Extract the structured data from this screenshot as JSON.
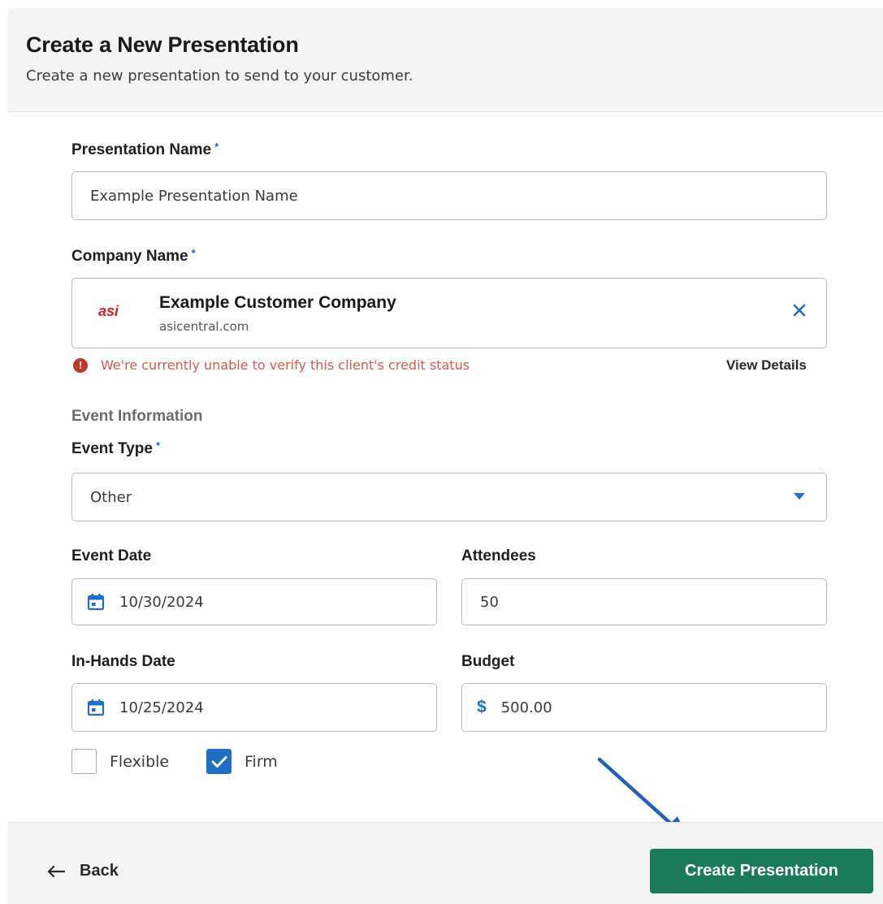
{
  "header": {
    "title": "Create a New Presentation",
    "subtitle": "Create a new presentation to send to your customer."
  },
  "form": {
    "presentation_name": {
      "label": "Presentation Name",
      "value": "Example Presentation Name"
    },
    "company_name": {
      "label": "Company Name",
      "selected_name": "Example Customer Company",
      "selected_domain": "asicentral.com",
      "logo_text": "asi",
      "warning": "We're currently unable to verify this client's credit status",
      "view_details": "View Details"
    },
    "event_section_title": "Event Information",
    "event_type": {
      "label": "Event Type",
      "value": "Other"
    },
    "event_date": {
      "label": "Event Date",
      "value": "10/30/2024"
    },
    "attendees": {
      "label": "Attendees",
      "value": "50"
    },
    "in_hands_date": {
      "label": "In-Hands Date",
      "value": "10/25/2024"
    },
    "budget": {
      "label": "Budget",
      "currency_symbol": "$",
      "value": "500.00"
    },
    "flexible": {
      "label": "Flexible",
      "checked": false
    },
    "firm": {
      "label": "Firm",
      "checked": true
    },
    "required_marker": "*"
  },
  "footer": {
    "back_label": "Back",
    "create_label": "Create Presentation"
  },
  "colors": {
    "accent_blue": "#1f6fc6",
    "primary_green": "#1b7a5c",
    "error_red": "#c0392b",
    "logo_red": "#d01f2e"
  }
}
